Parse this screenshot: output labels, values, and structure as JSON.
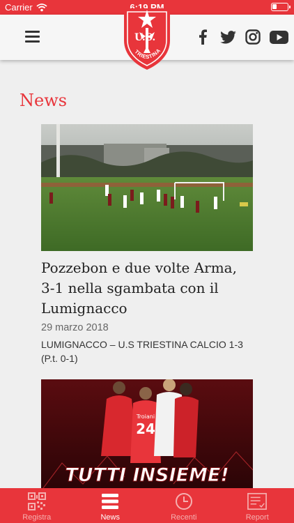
{
  "status_bar": {
    "carrier": "Carrier",
    "time": "6:19 PM"
  },
  "header": {
    "logo": {
      "text_top": "U.S.",
      "text_bottom": "TRIESTINA"
    },
    "social": [
      "facebook-icon",
      "twitter-icon",
      "instagram-icon",
      "youtube-icon"
    ]
  },
  "main": {
    "section_title": "News",
    "articles": [
      {
        "headline": "Pozzebon e due volte Arma, 3-1 nella sgambata con il Lumignacco",
        "date": "29 marzo 2018",
        "excerpt": "LUMIGNACCO – U.S TRIESTINA CALCIO 1-3 (P.t. 0-1)"
      },
      {
        "banner_text": "TUTTI INSIEME!",
        "jersey_name": "Troiani",
        "jersey_number": "24"
      }
    ]
  },
  "tabbar": {
    "tabs": [
      {
        "label": "Registra",
        "icon": "qr-code-icon",
        "active": false
      },
      {
        "label": "News",
        "icon": "list-icon",
        "active": true
      },
      {
        "label": "Recenti",
        "icon": "clock-icon",
        "active": false
      },
      {
        "label": "Report",
        "icon": "report-icon",
        "active": false
      }
    ]
  },
  "colors": {
    "accent": "#e8353b",
    "background": "#efefef",
    "header": "#f6f6f6"
  }
}
